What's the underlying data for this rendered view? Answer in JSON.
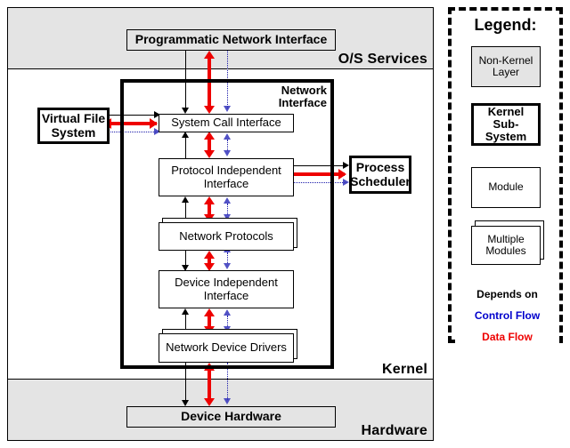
{
  "bands": [
    {
      "id": "os-services",
      "label": "O/S Services",
      "shaded": true
    },
    {
      "id": "kernel",
      "label": "Kernel",
      "shaded": false
    },
    {
      "id": "hardware",
      "label": "Hardware",
      "shaded": true
    }
  ],
  "subsystem": {
    "title_line1": "Network",
    "title_line2": "Interface"
  },
  "nodes": {
    "programmatic_network_interface": "Programmatic Network Interface",
    "virtual_file_system": "Virtual File\nSystem",
    "system_call_interface": "System Call Interface",
    "protocol_independent_interface": "Protocol Independent\nInterface",
    "network_protocols": "Network Protocols",
    "device_independent_interface": "Device Independent\nInterface",
    "network_device_drivers": "Network Device Drivers",
    "process_scheduler": "Process\nScheduler",
    "device_hardware": "Device Hardware"
  },
  "legend": {
    "title": "Legend:",
    "shapes": [
      {
        "name": "non-kernel-layer",
        "label": "Non-Kernel\nLayer",
        "style": "layer"
      },
      {
        "name": "kernel-sub-system",
        "label": "Kernel Sub-\nSystem",
        "style": "subsystem"
      },
      {
        "name": "module",
        "label": "Module",
        "style": "module"
      },
      {
        "name": "multiple-modules",
        "label": "Multiple\nModules",
        "style": "stack"
      }
    ],
    "lines": [
      {
        "name": "depends-on",
        "label": "Depends on",
        "color": "#000000",
        "style": "solid"
      },
      {
        "name": "control-flow",
        "label": "Control Flow",
        "color": "#0000cc",
        "style": "dotted"
      },
      {
        "name": "data-flow",
        "label": "Data Flow",
        "color": "#ee0000",
        "style": "thick-solid"
      }
    ]
  },
  "colors": {
    "depends_on": "#000000",
    "control_flow": "#0000cc",
    "data_flow": "#ee0000",
    "shaded_band": "#e4e4e4",
    "background": "#ffffff"
  }
}
